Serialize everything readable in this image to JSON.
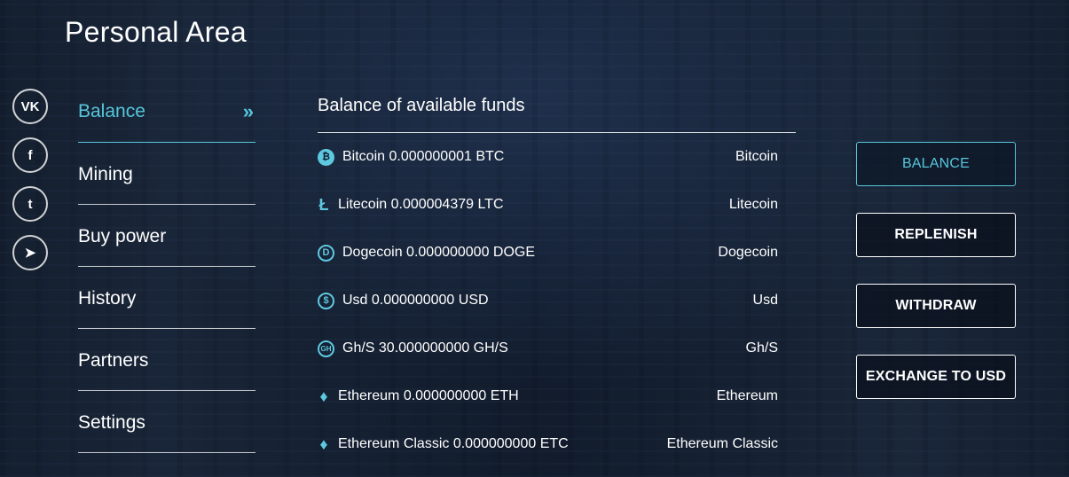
{
  "page": {
    "title": "Personal Area"
  },
  "social": [
    {
      "name": "vk-icon",
      "glyph": "VK"
    },
    {
      "name": "facebook-icon",
      "glyph": "f"
    },
    {
      "name": "twitter-icon",
      "glyph": "t"
    },
    {
      "name": "telegram-icon",
      "glyph": "➤"
    }
  ],
  "nav": {
    "items": [
      {
        "label": "Balance",
        "active": true
      },
      {
        "label": "Mining"
      },
      {
        "label": "Buy power"
      },
      {
        "label": "History"
      },
      {
        "label": "Partners"
      },
      {
        "label": "Settings"
      }
    ],
    "active_chevron": "»"
  },
  "balance": {
    "title": "Balance of available funds",
    "rows": [
      {
        "icon": "bitcoin-icon",
        "glyph": "₿",
        "text": "Bitcoin 0.000000001 BTC",
        "name": "Bitcoin"
      },
      {
        "icon": "litecoin-icon",
        "glyph": "Ł",
        "text": "Litecoin 0.000004379 LTC",
        "name": "Litecoin"
      },
      {
        "icon": "dogecoin-icon",
        "glyph": "D",
        "text": "Dogecoin 0.000000000 DOGE",
        "name": "Dogecoin"
      },
      {
        "icon": "usd-icon",
        "glyph": "$",
        "text": "Usd 0.000000000 USD",
        "name": "Usd"
      },
      {
        "icon": "ghs-icon",
        "glyph": "GH",
        "text": "Gh/S 30.000000000 GH/S",
        "name": "Gh/S"
      },
      {
        "icon": "ethereum-icon",
        "glyph": "♦",
        "text": "Ethereum 0.000000000 ETH",
        "name": "Ethereum"
      },
      {
        "icon": "ethereum-classic-icon",
        "glyph": "♦",
        "text": "Ethereum Classic 0.000000000 ETC",
        "name": "Ethereum Classic"
      }
    ]
  },
  "actions": {
    "balance": "BALANCE",
    "replenish": "REPLENISH",
    "withdraw": "WITHDRAW",
    "exchange": "EXCHANGE TO USD"
  },
  "colors": {
    "accent": "#56c6dc"
  }
}
